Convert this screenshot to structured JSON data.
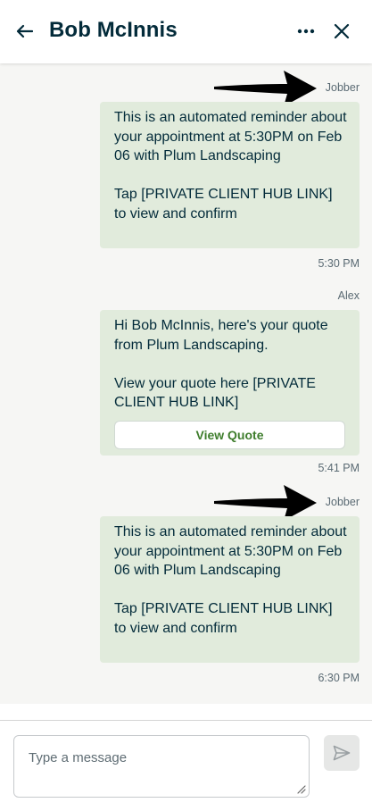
{
  "header": {
    "title": "Bob McInnis",
    "back_icon": "arrow-left-icon",
    "more_icon": "more-horizontal-icon",
    "close_icon": "close-icon"
  },
  "messages": [
    {
      "sender": "Jobber",
      "text": "This is an automated reminder about your appointment at 5:30PM on Feb 06 with Plum Landscaping\n\nTap [PRIVATE CLIENT HUB LINK] to view and confirm",
      "time": "5:30 PM"
    },
    {
      "sender": "Alex",
      "text": "Hi Bob McInnis, here's your quote from Plum Landscaping.\n\nView your quote here [PRIVATE CLIENT HUB LINK]",
      "button_label": "View Quote",
      "time": "5:41 PM"
    },
    {
      "sender": "Jobber",
      "text": "This is an automated reminder about your appointment at 5:30PM on Feb 06 with Plum Landscaping\n\nTap [PRIVATE CLIENT HUB LINK] to view and confirm",
      "time": "6:30 PM"
    }
  ],
  "composer": {
    "placeholder": "Type a message",
    "send_icon": "send-icon"
  },
  "colors": {
    "bubble": "#e1ebdc",
    "accent_green": "#3e7d2c",
    "text_dark": "#032b3a"
  }
}
